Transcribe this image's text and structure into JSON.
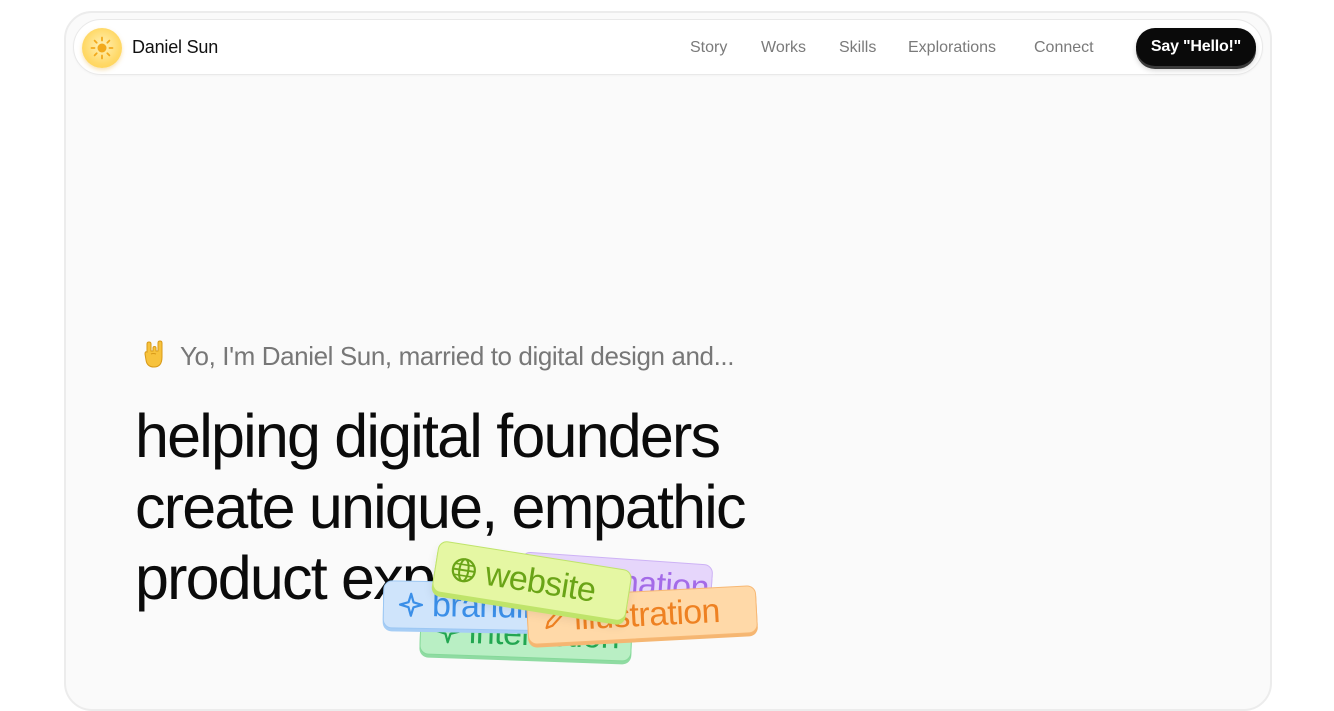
{
  "brand": {
    "name": "Daniel Sun",
    "logo_icon": "sun-icon"
  },
  "nav": {
    "links": [
      "Story",
      "Works",
      "Skills",
      "Explorations",
      "Connect"
    ],
    "cta_label": "Say \"Hello!\""
  },
  "hero": {
    "intro_emoji": "rock-on-hand-icon",
    "intro": "Yo, I'm Daniel Sun, married to digital design and...",
    "headline_lines": [
      "helping digital founders",
      "create unique, empathic",
      "product experiences"
    ]
  },
  "chips": [
    {
      "label": "interaction",
      "icon": "sparkle-icon",
      "color": "#22a651",
      "bg": "#b9efc4"
    },
    {
      "label": "animation",
      "icon": "play-icon",
      "color": "#a46be8",
      "bg": "#e6d6fb"
    },
    {
      "label": "branding",
      "icon": "sparkle-icon",
      "color": "#3b8fe8",
      "bg": "#cfe4fb"
    },
    {
      "label": "illustration",
      "icon": "pen-icon",
      "color": "#ee8122",
      "bg": "#ffd9a8"
    },
    {
      "label": "website",
      "icon": "globe-icon",
      "color": "#6aa417",
      "bg": "#e5f7a3"
    }
  ],
  "colors": {
    "accent": "#0a0a0a",
    "muted_text": "#7a7a7a",
    "frame_bg": "#fafafa"
  }
}
